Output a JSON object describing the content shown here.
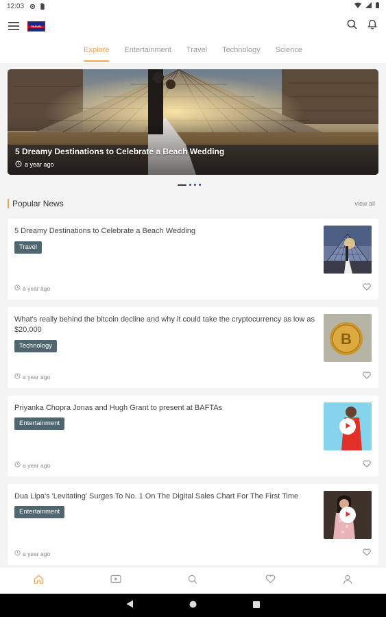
{
  "status_bar": {
    "time": "12:03"
  },
  "colors": {
    "accent": "#f2a65a",
    "tag_bg": "#4f6570",
    "dot_blue": "#2d4a8a"
  },
  "header": {
    "logo_text": "TRAVEL",
    "icons": [
      "menu-icon",
      "search-icon",
      "bell-icon"
    ]
  },
  "tabs": [
    {
      "label": "Explore",
      "active": true
    },
    {
      "label": "Entertainment",
      "active": false
    },
    {
      "label": "Travel",
      "active": false
    },
    {
      "label": "Technology",
      "active": false
    },
    {
      "label": "Science",
      "active": false
    }
  ],
  "hero": {
    "title": "5 Dreamy Destinations to Celebrate a Beach Wedding",
    "time": "a year ago",
    "slide_count": 4,
    "active_slide": 1
  },
  "popular": {
    "title": "Popular News",
    "view_all": "view all",
    "items": [
      {
        "headline": "5 Dreamy Destinations to Celebrate a Beach Wedding",
        "tag": "Travel",
        "time": "a year ago",
        "thumb": "louvre-wedding",
        "video": false
      },
      {
        "headline": "What's really behind the bitcoin decline and why it could take the cryptocurrency as low as $20,000",
        "tag": "Technology",
        "time": "a year ago",
        "thumb": "bitcoin-coin",
        "video": false
      },
      {
        "headline": "Priyanka Chopra Jonas and Hugh Grant to present at BAFTAs",
        "tag": "Entertainment",
        "time": "a year ago",
        "thumb": "priyanka-red-dress",
        "video": true
      },
      {
        "headline": "Dua Lipa's 'Levitating' Surges To No. 1 On The Digital Sales Chart For The First Time",
        "tag": "Entertainment",
        "time": "a year ago",
        "thumb": "dua-lipa",
        "video": true
      }
    ]
  },
  "bottom_nav": [
    {
      "icon": "home-icon",
      "active": true
    },
    {
      "icon": "video-icon",
      "active": false
    },
    {
      "icon": "search-icon",
      "active": false
    },
    {
      "icon": "heart-icon",
      "active": false
    },
    {
      "icon": "profile-icon",
      "active": false
    }
  ]
}
